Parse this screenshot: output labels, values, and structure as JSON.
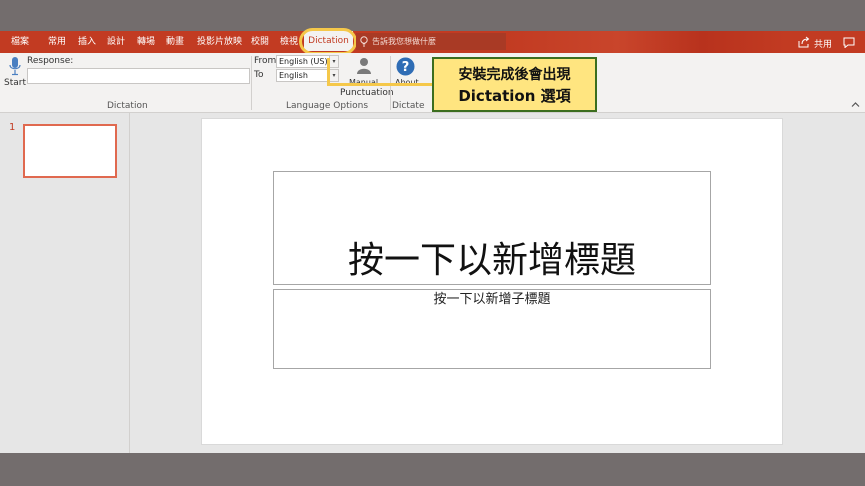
{
  "menu": {
    "items": [
      "檔案",
      "常用",
      "插入",
      "設計",
      "轉場",
      "動畫",
      "投影片放映",
      "校閱",
      "檢視"
    ],
    "active_tab": "Dictation",
    "tellme_placeholder": "告訴我您想做什麼",
    "share_label": "共用"
  },
  "ribbon": {
    "start_label": "Start",
    "response_label": "Response:",
    "response_value": "",
    "dictation_group_label": "Dictation",
    "from_label": "From",
    "from_value": "English (US)",
    "to_label": "To",
    "to_value": "English",
    "language_group_label": "Language Options",
    "manual_label": "Manual",
    "punctuation_label": "Punctuation",
    "about_label": "About",
    "dictate_group_label": "Dictate"
  },
  "callout": {
    "line1": "安裝完成後會出現",
    "line2": "Dictation 選項"
  },
  "thumbnails": {
    "number": "1"
  },
  "slide": {
    "title_placeholder": "按一下以新增標題",
    "subtitle_placeholder": "按一下以新增子標題"
  },
  "colors": {
    "accent": "#c23b22",
    "highlight": "#f5c84a",
    "callout_fill": "#ffe580",
    "callout_border": "#3c6e1f"
  }
}
